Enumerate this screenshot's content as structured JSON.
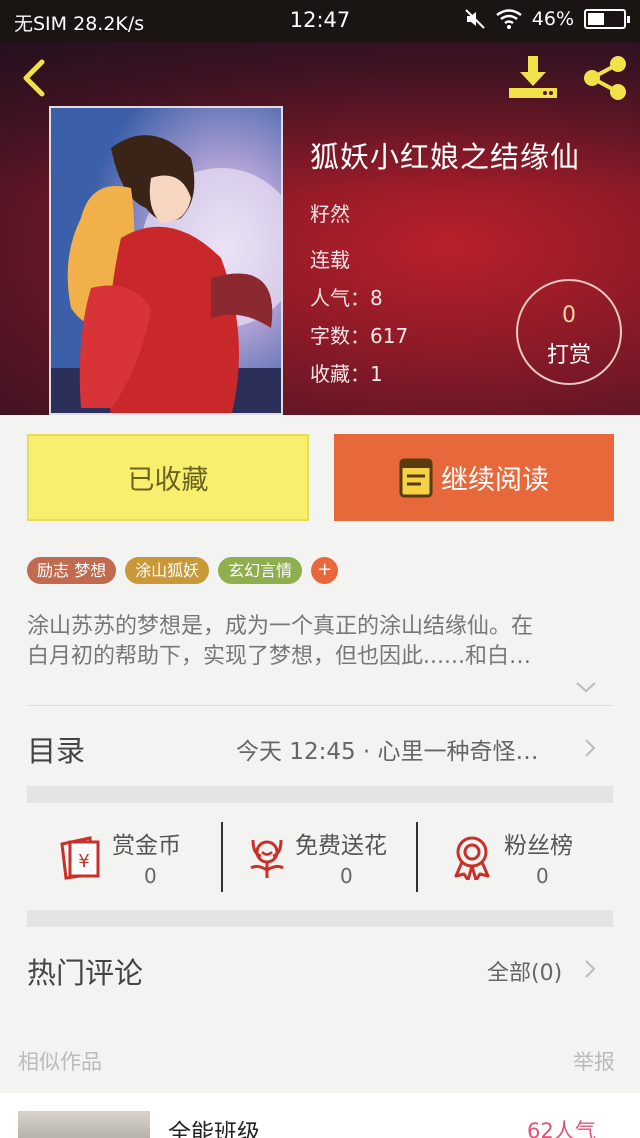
{
  "status_bar": {
    "carrier": "无SIM",
    "speed": "28.2K/s",
    "time": "12:47",
    "battery": "46%",
    "battery_level": 0.46
  },
  "book": {
    "title": "狐妖小红娘之结缘仙",
    "author": "籽然",
    "status": "连载",
    "popularity": "人气：8",
    "word_count": "字数：617",
    "favorites": "收藏：1",
    "reward_count": "0",
    "reward_label": "打赏"
  },
  "actions": {
    "collected_label": "已收藏",
    "continue_label": "继续阅读"
  },
  "tags": [
    {
      "label": "励志 梦想",
      "color": "#c06a4f"
    },
    {
      "label": "涂山狐妖",
      "color": "#c99838"
    },
    {
      "label": "玄幻言情",
      "color": "#8fae4e"
    }
  ],
  "tag_add": "+",
  "description": {
    "line1": "涂山苏苏的梦想是，成为一个真正的涂山结缘仙。在",
    "line2": "白月初的帮助下，实现了梦想，但也因此......和白…"
  },
  "catalog": {
    "label": "目录",
    "latest": "今天 12:45 · 心里一种奇怪…"
  },
  "stats": [
    {
      "label": "赏金币",
      "value": "0",
      "icon": "red-envelope-yen-icon"
    },
    {
      "label": "免费送花",
      "value": "0",
      "icon": "flower-icon"
    },
    {
      "label": "粉丝榜",
      "value": "0",
      "icon": "ribbon-medal-icon"
    }
  ],
  "comments": {
    "label": "热门评论",
    "all": "全部(0)"
  },
  "similar": {
    "label": "相似作品",
    "report": "举报",
    "items": [
      {
        "title": "全能班级",
        "popularity": "62人气"
      }
    ]
  },
  "colors": {
    "accent_orange": "#e6683b",
    "collected_yellow": "#f8ef6e",
    "icon_yellow": "#f1e24a",
    "stat_icon_red": "#c8312a"
  }
}
